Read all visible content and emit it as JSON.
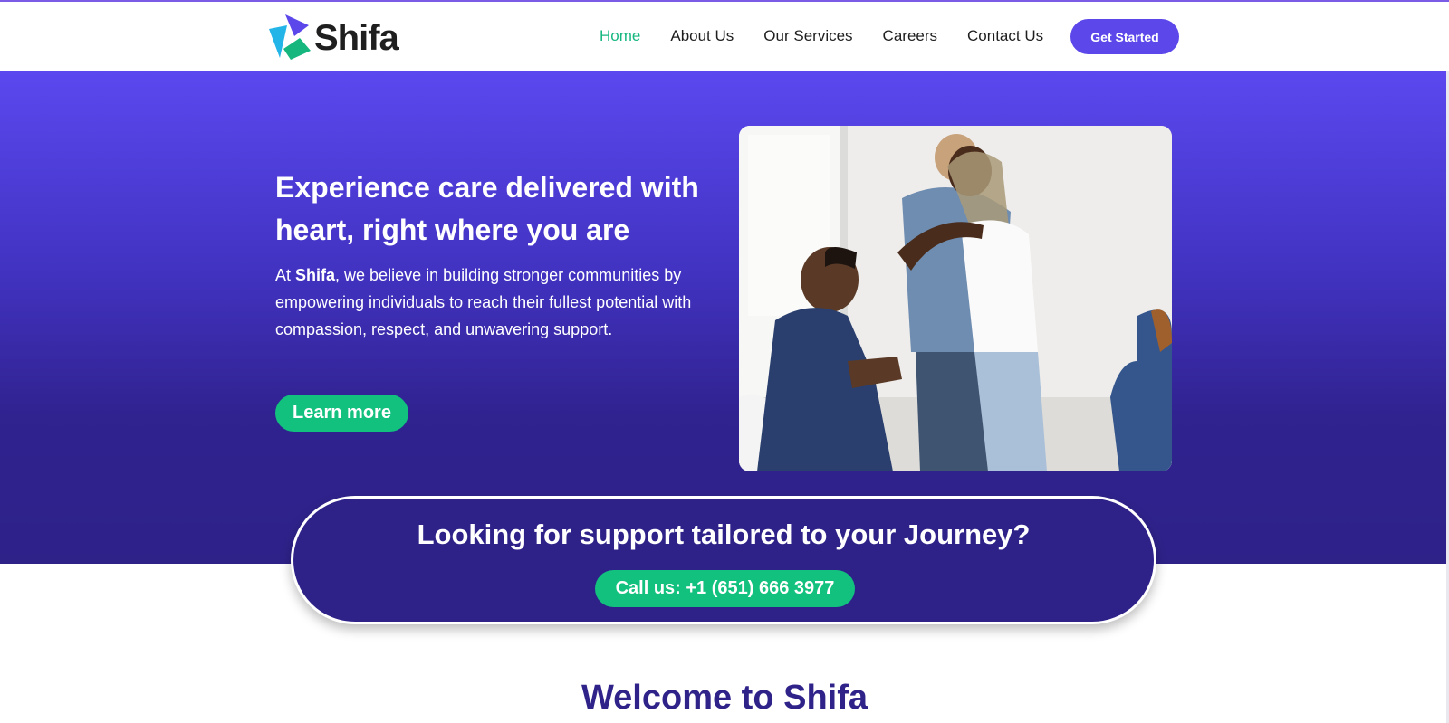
{
  "brand": {
    "name": "Shifa",
    "logo_icon": "shifa-logo-icon",
    "colors": {
      "primary": "#5b47ea",
      "accent_green": "#12c17e",
      "dark_purple": "#2e2289"
    }
  },
  "nav": {
    "items": [
      {
        "label": "Home",
        "active": true
      },
      {
        "label": "About Us",
        "active": false
      },
      {
        "label": "Our Services",
        "active": false
      },
      {
        "label": "Careers",
        "active": false
      },
      {
        "label": "Contact Us",
        "active": false
      }
    ],
    "cta_label": "Get Started"
  },
  "hero": {
    "title": "Experience care delivered with heart, right where you are",
    "text_prefix": "At ",
    "text_brand": "Shifa",
    "text_suffix": ", we believe in building stronger communities by empowering individuals to reach their fullest potential with compassion, respect, and unwavering support.",
    "button_label": "Learn more"
  },
  "support": {
    "title": "Looking for support tailored to your Journey?",
    "call_label": "Call us: +1 (651) 666 3977"
  },
  "welcome": {
    "title": "Welcome to Shifa"
  }
}
